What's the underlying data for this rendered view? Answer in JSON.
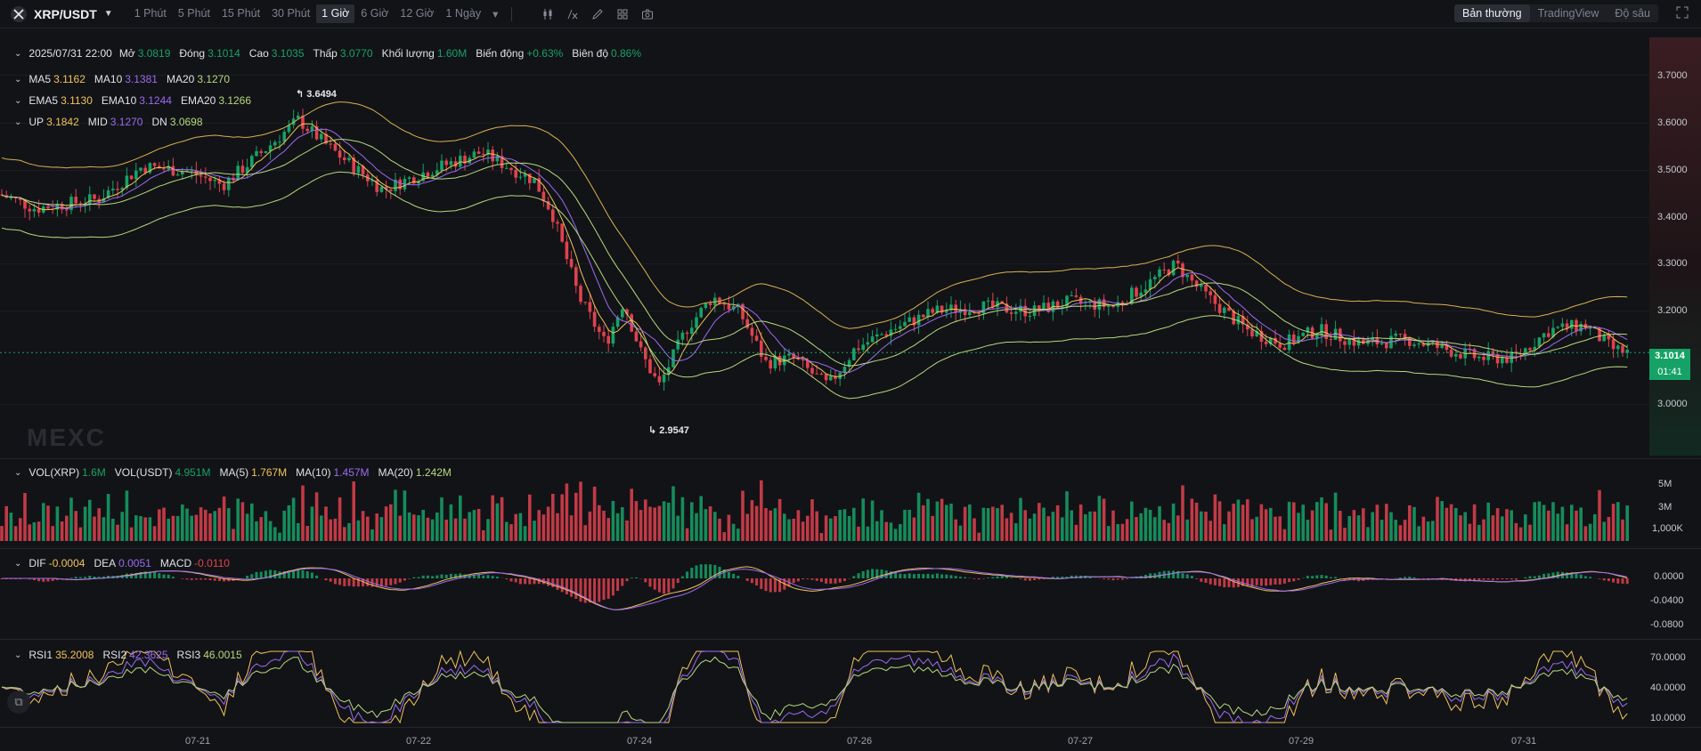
{
  "header": {
    "symbol": "XRP/USDT",
    "intervals": [
      "1 Phút",
      "5 Phút",
      "15 Phút",
      "30 Phút",
      "1 Giờ",
      "6 Giờ",
      "12 Giờ",
      "1 Ngày"
    ],
    "active_interval": "1 Giờ",
    "views": [
      "Bản thường",
      "TradingView",
      "Độ sâu"
    ],
    "active_view": "Bản thường"
  },
  "ohlc": {
    "date": "2025/07/31 22:00",
    "open_label": "Mở",
    "open": "3.0819",
    "close_label": "Đóng",
    "close": "3.1014",
    "high_label": "Cao",
    "high": "3.1035",
    "low_label": "Thấp",
    "low": "3.0770",
    "volume_label": "Khối lượng",
    "volume": "1.60M",
    "change_label": "Biến động",
    "change": "+0.63%",
    "amplitude_label": "Biên độ",
    "amplitude": "0.86%"
  },
  "ma": {
    "ma5_label": "MA5",
    "ma5": "3.1162",
    "ma10_label": "MA10",
    "ma10": "3.1381",
    "ma20_label": "MA20",
    "ma20": "3.1270"
  },
  "ema": {
    "ema5_label": "EMA5",
    "ema5": "3.1130",
    "ema10_label": "EMA10",
    "ema10": "3.1244",
    "ema20_label": "EMA20",
    "ema20": "3.1266"
  },
  "boll": {
    "up_label": "UP",
    "up": "3.1842",
    "mid_label": "MID",
    "mid": "3.1270",
    "dn_label": "DN",
    "dn": "3.0698"
  },
  "price_axis": [
    "3.7000",
    "3.6000",
    "3.5000",
    "3.4000",
    "3.3000",
    "3.2000",
    "3.0000"
  ],
  "last_price": "3.1014",
  "countdown": "01:41",
  "high_mark": "3.6494",
  "low_mark": "2.9547",
  "watermark": "MEXC",
  "vol": {
    "vol_xrp_label": "VOL(XRP)",
    "vol_xrp": "1.6M",
    "vol_usdt_label": "VOL(USDT)",
    "vol_usdt": "4.951M",
    "ma5_label": "MA(5)",
    "ma5": "1.767M",
    "ma10_label": "MA(10)",
    "ma10": "1.457M",
    "ma20_label": "MA(20)",
    "ma20": "1.242M"
  },
  "vol_axis": [
    "5M",
    "3M",
    "1,000K"
  ],
  "macd": {
    "dif_label": "DIF",
    "dif": "-0.0004",
    "dea_label": "DEA",
    "dea": "0.0051",
    "macd_label": "MACD",
    "macd": "-0.0110"
  },
  "macd_axis": [
    "0.0000",
    "-0.0400",
    "-0.0800"
  ],
  "rsi": {
    "rsi1_label": "RSI1",
    "rsi1": "35.2008",
    "rsi2_label": "RSI2",
    "rsi2": "42.3625",
    "rsi3_label": "RSI3",
    "rsi3": "46.0015"
  },
  "rsi_axis": [
    "70.0000",
    "40.0000",
    "10.0000"
  ],
  "dates": [
    "07-21",
    "07-22",
    "07-24",
    "07-26",
    "07-27",
    "07-29",
    "07-31"
  ],
  "colors": {
    "up": "#16a267",
    "down": "#e0424d",
    "ma5": "#f0c35a",
    "ma10": "#9b6cf0",
    "ma20": "#b6d97c",
    "boll": "#d9b14f"
  },
  "icons": [
    "logo-icon",
    "candle-icon",
    "indicator-icon",
    "draw-icon",
    "layout-icon",
    "camera-icon",
    "fullscreen-icon",
    "screenshot-icon"
  ]
}
